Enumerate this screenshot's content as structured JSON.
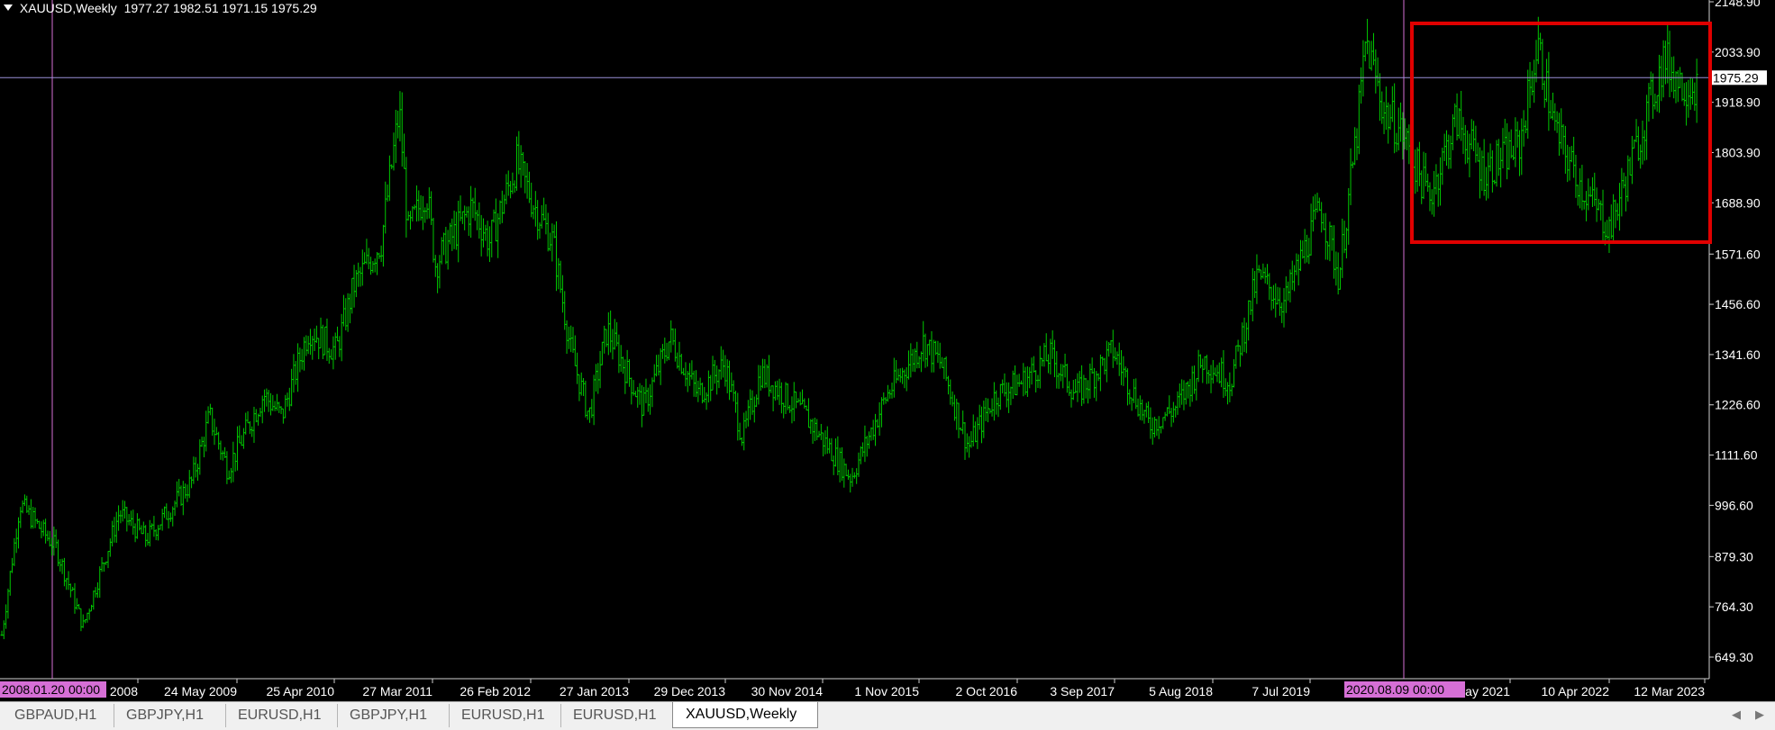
{
  "header": {
    "symbol": "XAUUSD,Weekly",
    "ohlc": "1977.27 1982.51 1971.15 1975.29"
  },
  "colors": {
    "background": "#000000",
    "bars": "#00c800",
    "grid_text": "#ffffff",
    "crosshair": "#9b8fd8",
    "vertical_line": "#d66fd6",
    "highlight_box": "#e00000",
    "date_label_bg": "#d66fd6"
  },
  "chart_data": {
    "type": "ohlc-bar",
    "instrument": "XAUUSD",
    "timeframe": "Weekly",
    "y_ticks": [
      "2148.90",
      "2033.90",
      "1918.90",
      "1803.90",
      "1688.90",
      "1571.60",
      "1456.60",
      "1341.60",
      "1226.60",
      "1111.60",
      "996.60",
      "879.30",
      "764.30",
      "649.30"
    ],
    "ylim": [
      649.3,
      2148.9
    ],
    "x_ticks": [
      "Jun 2008",
      "24 May 2009",
      "25 Apr 2010",
      "27 Mar 2011",
      "26 Feb 2012",
      "27 Jan 2013",
      "29 Dec 2013",
      "30 Nov 2014",
      "1 Nov 2015",
      "2 Oct 2016",
      "3 Sep 2017",
      "5 Aug 2018",
      "7 Jul 2019",
      "9 May 2021",
      "10 Apr 2022",
      "12 Mar 2023"
    ],
    "current_price": "1975.29",
    "vertical_line_labels": [
      "2008.01.20 00:00",
      "2020.08.09 00:00"
    ],
    "price_path": [
      [
        "2008-01",
        700
      ],
      [
        "2008-03",
        1000
      ],
      [
        "2008-07",
        900
      ],
      [
        "2008-10",
        720
      ],
      [
        "2009-02",
        980
      ],
      [
        "2009-05",
        920
      ],
      [
        "2009-10",
        1050
      ],
      [
        "2009-12",
        1200
      ],
      [
        "2010-02",
        1080
      ],
      [
        "2010-06",
        1250
      ],
      [
        "2010-08",
        1200
      ],
      [
        "2010-11",
        1400
      ],
      [
        "2011-02",
        1350
      ],
      [
        "2011-04",
        1500
      ],
      [
        "2011-07",
        1600
      ],
      [
        "2011-09",
        1900
      ],
      [
        "2011-10",
        1620
      ],
      [
        "2011-12",
        1720
      ],
      [
        "2012-01",
        1550
      ],
      [
        "2012-05",
        1680
      ],
      [
        "2012-07",
        1600
      ],
      [
        "2012-10",
        1780
      ],
      [
        "2012-12",
        1680
      ],
      [
        "2013-02",
        1600
      ],
      [
        "2013-04",
        1350
      ],
      [
        "2013-06",
        1200
      ],
      [
        "2013-08",
        1400
      ],
      [
        "2013-12",
        1220
      ],
      [
        "2014-03",
        1380
      ],
      [
        "2014-06",
        1250
      ],
      [
        "2014-09",
        1320
      ],
      [
        "2014-11",
        1150
      ],
      [
        "2015-01",
        1300
      ],
      [
        "2015-06",
        1200
      ],
      [
        "2015-11",
        1060
      ],
      [
        "2016-03",
        1250
      ],
      [
        "2016-07",
        1370
      ],
      [
        "2016-09",
        1320
      ],
      [
        "2016-12",
        1130
      ],
      [
        "2017-03",
        1250
      ],
      [
        "2017-06",
        1280
      ],
      [
        "2017-09",
        1340
      ],
      [
        "2017-12",
        1250
      ],
      [
        "2018-04",
        1350
      ],
      [
        "2018-08",
        1180
      ],
      [
        "2018-11",
        1220
      ],
      [
        "2019-02",
        1330
      ],
      [
        "2019-05",
        1280
      ],
      [
        "2019-08",
        1520
      ],
      [
        "2019-11",
        1460
      ],
      [
        "2020-03",
        1680
      ],
      [
        "2020-05",
        1520
      ],
      [
        "2020-07",
        1850
      ],
      [
        "2020-08",
        2060
      ],
      [
        "2020-10",
        1900
      ],
      [
        "2020-12",
        1850
      ],
      [
        "2021-03",
        1700
      ],
      [
        "2021-06",
        1880
      ],
      [
        "2021-09",
        1760
      ],
      [
        "2022-01",
        1820
      ],
      [
        "2022-03",
        2050
      ],
      [
        "2022-05",
        1850
      ],
      [
        "2022-08",
        1720
      ],
      [
        "2022-11",
        1630
      ],
      [
        "2023-02",
        1820
      ],
      [
        "2023-05",
        2020
      ],
      [
        "2023-07",
        1960
      ]
    ]
  },
  "tabs": [
    {
      "label": "GBPAUD,H1",
      "active": false
    },
    {
      "label": "GBPJPY,H1",
      "active": false
    },
    {
      "label": "EURUSD,H1",
      "active": false
    },
    {
      "label": "GBPJPY,H1",
      "active": false
    },
    {
      "label": "EURUSD,H1",
      "active": false
    },
    {
      "label": "EURUSD,H1",
      "active": false
    },
    {
      "label": "XAUUSD,Weekly",
      "active": true
    }
  ],
  "nav": {
    "left": "◀",
    "right": "▶"
  }
}
